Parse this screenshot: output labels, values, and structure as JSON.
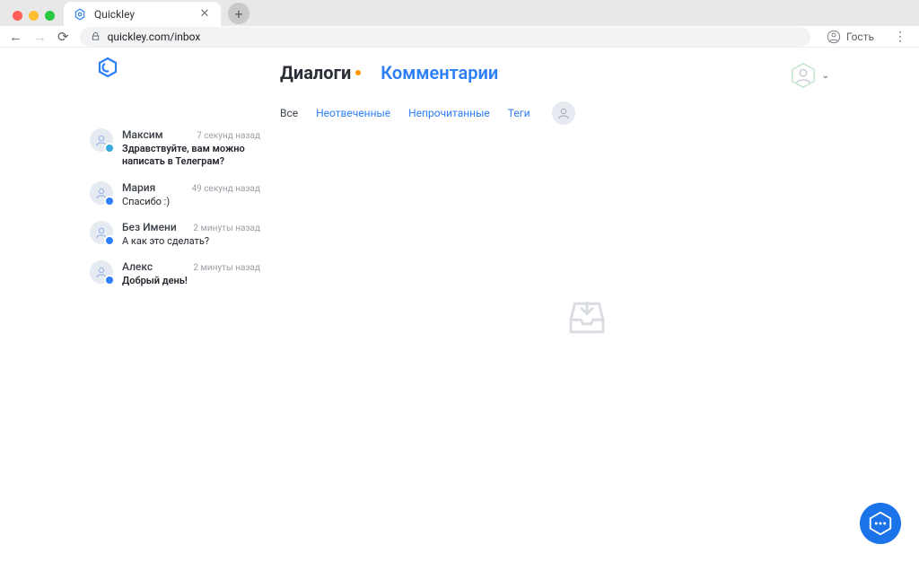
{
  "browser": {
    "tab_title": "Quickley",
    "url": "quickley.com/inbox",
    "profile_label": "Гость"
  },
  "app": {
    "tabs": {
      "dialogs": "Диалоги",
      "comments": "Комментарии"
    },
    "filters": {
      "all": "Все",
      "unanswered": "Неотвеченные",
      "unread": "Непрочитанные",
      "tags": "Теги"
    },
    "dialogs": [
      {
        "name": "Максим",
        "time": "7 секунд назад",
        "msg": "Здравствуйте, вам можно написать в Телеграм?",
        "bold": true,
        "badge": "tg"
      },
      {
        "name": "Мария",
        "time": "49 секунд назад",
        "msg": "Спасибо :)",
        "bold": false,
        "badge": "blue"
      },
      {
        "name": "Без Имени",
        "time": "2 минуты назад",
        "msg": "А как это сделать?",
        "bold": false,
        "badge": "blue"
      },
      {
        "name": "Алекс",
        "time": "2 минуты назад",
        "msg": "Добрый день!",
        "bold": true,
        "badge": "blue"
      }
    ]
  }
}
